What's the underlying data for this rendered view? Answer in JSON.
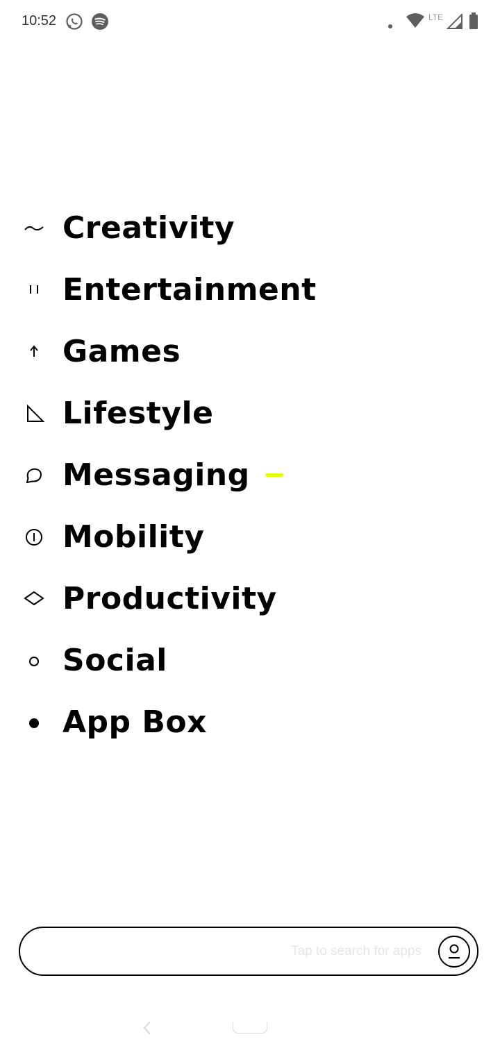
{
  "status_bar": {
    "time": "10:52",
    "notification_icons": [
      "whatsapp-icon",
      "spotify-icon"
    ],
    "system_icons": [
      "dot-icon",
      "wifi-icon",
      "signal-icon",
      "battery-icon"
    ],
    "network_label": "LTE"
  },
  "categories": [
    {
      "label": "Creativity",
      "icon": "tilde-icon"
    },
    {
      "label": "Entertainment",
      "icon": "pause-bars-icon"
    },
    {
      "label": "Games",
      "icon": "arrow-up-icon"
    },
    {
      "label": "Lifestyle",
      "icon": "triangle-icon"
    },
    {
      "label": "Messaging",
      "icon": "speech-bubble-icon",
      "accent": "#e4ff00"
    },
    {
      "label": "Mobility",
      "icon": "circle-line-icon"
    },
    {
      "label": "Productivity",
      "icon": "diamond-icon"
    },
    {
      "label": "Social",
      "icon": "small-circle-icon"
    },
    {
      "label": "App Box",
      "icon": "filled-dot-icon"
    }
  ],
  "search": {
    "placeholder": "Tap to search for apps",
    "action_icon": "account-icon"
  },
  "navigation": {
    "back_icon": "chevron-left-icon",
    "home_icon": "home-pill-icon"
  },
  "colors": {
    "accent": "#e4ff00",
    "text": "#000000",
    "background": "#ffffff"
  }
}
